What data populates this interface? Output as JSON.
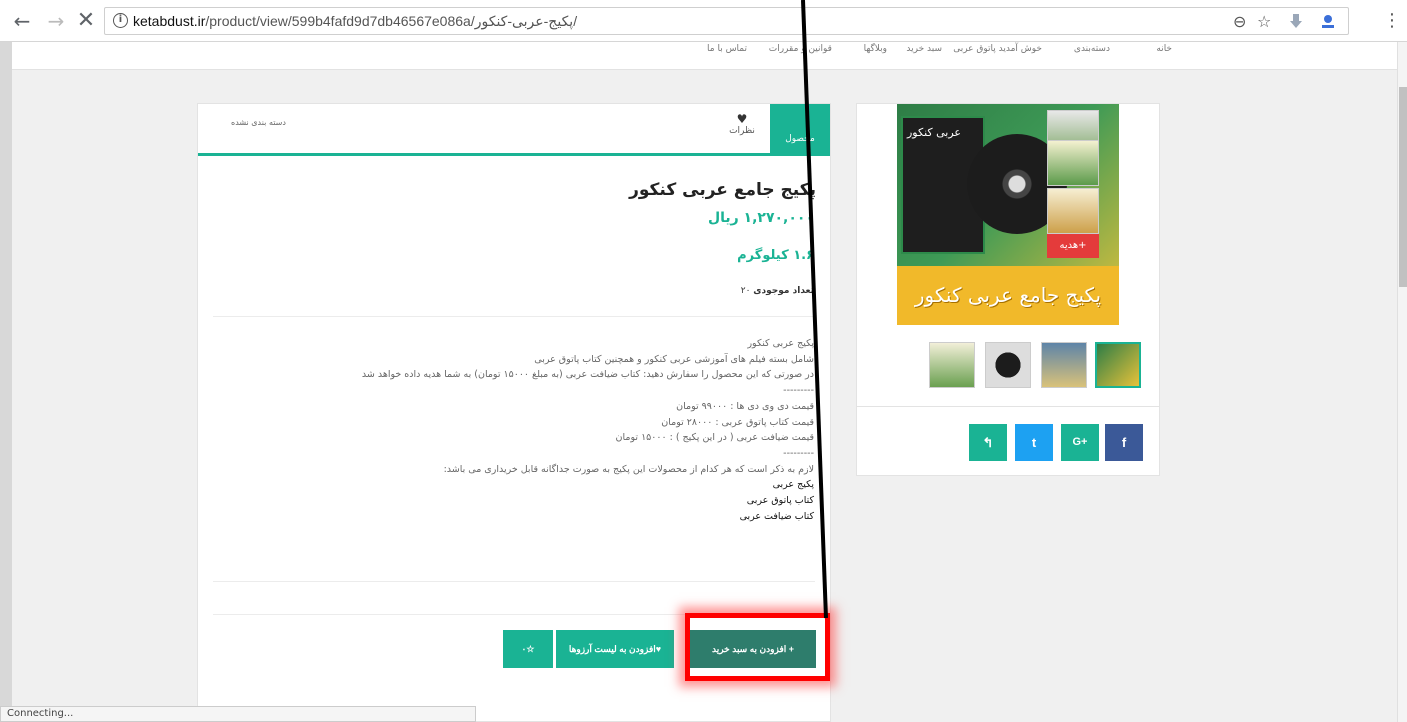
{
  "browser": {
    "back_icon": "back-arrow-icon",
    "forward_icon": "forward-arrow-icon",
    "stop_icon": "close-icon",
    "url_host": "ketabdust.ir",
    "url_path": "/product/view/599b4fafd9d7db46567e086a/پکیج-عربی-کنکور/",
    "status_text": "Connecting..."
  },
  "site_nav": {
    "items": [
      "خانه",
      "دسته‌بندی",
      "خوش آمدید پاتوق عربی",
      "سبد خرید",
      "وبلاگها",
      "قوانین و مقررات",
      "تماس با ما"
    ]
  },
  "gallery": {
    "box_title": "عربی کنکور",
    "gift_label": "+هدیه",
    "banner_text": "پکیج جامع عربی کنکور"
  },
  "share": {
    "buttons": [
      {
        "icon": "reply-icon",
        "label": "↰",
        "color": "#1ab394"
      },
      {
        "icon": "twitter-icon",
        "label": "t",
        "color": "#1da1f2"
      },
      {
        "icon": "google-plus-icon",
        "label": "G+",
        "color": "#1ab394"
      },
      {
        "icon": "facebook-icon",
        "label": "f",
        "color": "#3b5998"
      }
    ]
  },
  "tabs": {
    "product": "محصول",
    "reviews": "نظرات",
    "uncategorized": "دسته بندی نشده"
  },
  "product": {
    "title": "پکیج جامع عربی کنکور",
    "price": "۱,۲۷۰,۰۰۰ ریال",
    "weight": "۱.۶ کیلوگرم",
    "stock_label": "تعداد موجودی",
    "stock_value": "۲۰",
    "description": [
      "پکیج عربی کنکور",
      "شامل بسته فیلم های آموزشی عربی کنکور و همچنین کتاب پاتوق عربی",
      "در صورتی که این محصول را سفارش دهید: کتاب ضیافت عربی (به مبلغ ۱۵۰۰۰ تومان) به شما هدیه داده خواهد شد",
      "---------",
      "قیمت دی وی دی ها : ۹۹۰۰۰ تومان",
      "قیمت کتاب پاتوق عربی : ۲۸۰۰۰ تومان",
      "قیمت ضیافت عربی ( در این پکیج ) : ۱۵۰۰۰ تومان",
      "---------",
      "لازم به ذکر است که هر کدام از محصولات این پکیج به صورت جداگانه قابل خریداری می باشد:",
      "پکیج عربی",
      "کتاب پاتوق عربی",
      "کتاب ضیافت عربی"
    ]
  },
  "actions": {
    "add_to_cart": "+ افزودن به سبد خرید",
    "add_to_wishlist": "♥افزودن به لیست آرزوها",
    "rating": "☆٠"
  },
  "colors": {
    "accent": "#1ab394",
    "highlight": "#ff0000"
  }
}
